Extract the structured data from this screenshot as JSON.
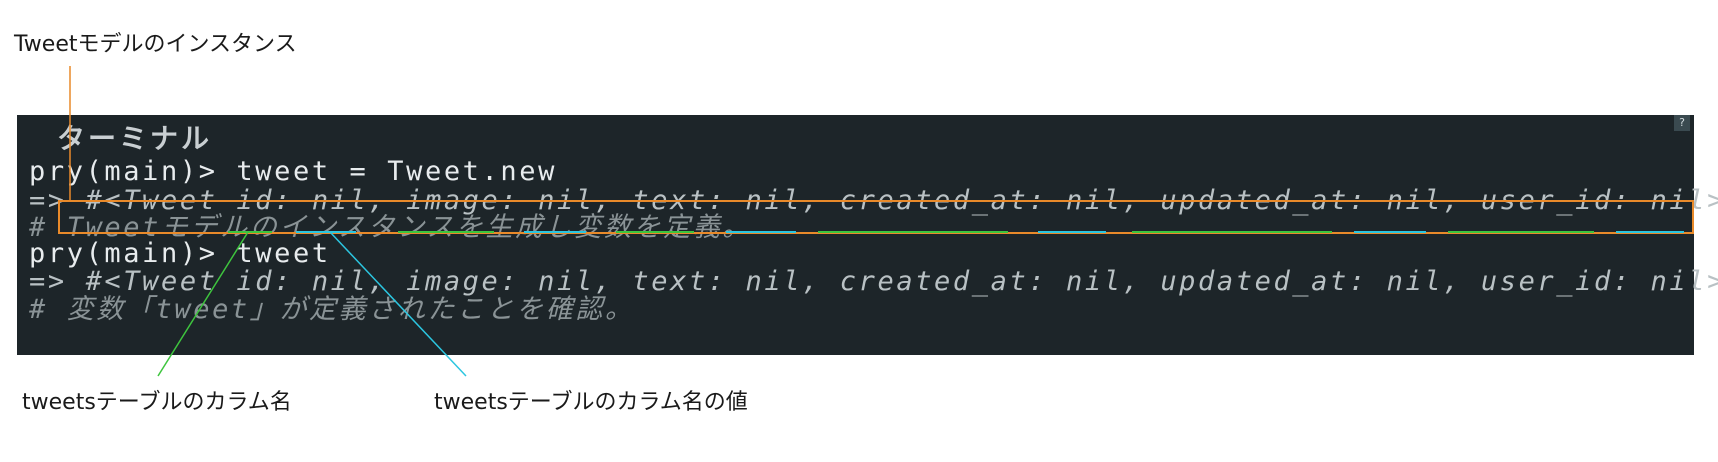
{
  "annotations": {
    "instance_label": "Tweetモデルのインスタンス",
    "column_label": "tweetsテーブルのカラム名",
    "value_label": "tweetsテーブルのカラム名の値"
  },
  "terminal": {
    "title": "ターミナル",
    "help": "?",
    "lines": [
      "pry(main)> tweet = Tweet.new",
      "=> #<Tweet id: nil, image: nil, text: nil, created_at: nil, updated_at: nil, user_id: nil>",
      "# Tweetモデルのインスタンスを生成し変数を定義。",
      "pry(main)> tweet",
      "=> #<Tweet id: nil, image: nil, text: nil, created_at: nil, updated_at: nil, user_id: nil>",
      "# 変数「tweet」が定義されたことを確認。"
    ]
  },
  "colors": {
    "terminal_bg": "#1d2529",
    "highlight_box": "#e98a2a",
    "column_underline": "#3ec53e",
    "value_underline": "#2cc6e0"
  }
}
